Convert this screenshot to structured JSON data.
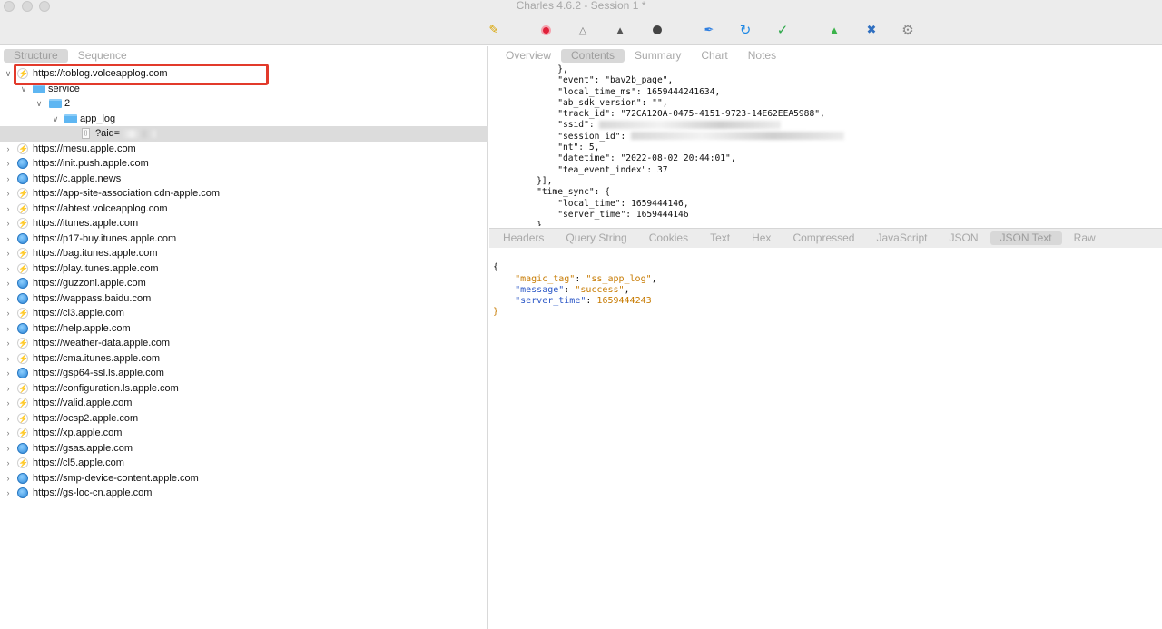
{
  "window": {
    "title": "Charles 4.6.2 - Session 1 *"
  },
  "toolbar": {
    "icons": [
      "broom-icon",
      "record-icon",
      "throttle-icon",
      "turtle-icon",
      "stop-icon",
      "pen-icon",
      "refresh-icon",
      "check-icon",
      "basket-icon",
      "tools-icon",
      "settings-icon"
    ]
  },
  "left_tabs": [
    "Structure",
    "Sequence"
  ],
  "tree": {
    "root": "https://toblog.volceapplog.com",
    "folders": [
      "service",
      "2",
      "app_log"
    ],
    "request": "?aid=",
    "hosts": [
      {
        "label": "https://mesu.apple.com",
        "icon": "bolt"
      },
      {
        "label": "https://init.push.apple.com",
        "icon": "globe"
      },
      {
        "label": "https://c.apple.news",
        "icon": "globe"
      },
      {
        "label": "https://app-site-association.cdn-apple.com",
        "icon": "bolt"
      },
      {
        "label": "https://abtest.volceapplog.com",
        "icon": "bolt"
      },
      {
        "label": "https://itunes.apple.com",
        "icon": "bolt"
      },
      {
        "label": "https://p17-buy.itunes.apple.com",
        "icon": "globe"
      },
      {
        "label": "https://bag.itunes.apple.com",
        "icon": "bolt"
      },
      {
        "label": "https://play.itunes.apple.com",
        "icon": "bolt"
      },
      {
        "label": "https://guzzoni.apple.com",
        "icon": "globe"
      },
      {
        "label": "https://wappass.baidu.com",
        "icon": "globe"
      },
      {
        "label": "https://cl3.apple.com",
        "icon": "bolt"
      },
      {
        "label": "https://help.apple.com",
        "icon": "globe"
      },
      {
        "label": "https://weather-data.apple.com",
        "icon": "bolt"
      },
      {
        "label": "https://cma.itunes.apple.com",
        "icon": "bolt"
      },
      {
        "label": "https://gsp64-ssl.ls.apple.com",
        "icon": "globe"
      },
      {
        "label": "https://configuration.ls.apple.com",
        "icon": "bolt"
      },
      {
        "label": "https://valid.apple.com",
        "icon": "bolt"
      },
      {
        "label": "https://ocsp2.apple.com",
        "icon": "bolt"
      },
      {
        "label": "https://xp.apple.com",
        "icon": "bolt"
      },
      {
        "label": "https://gsas.apple.com",
        "icon": "globe"
      },
      {
        "label": "https://cl5.apple.com",
        "icon": "bolt"
      },
      {
        "label": "https://smp-device-content.apple.com",
        "icon": "globe"
      },
      {
        "label": "https://gs-loc-cn.apple.com",
        "icon": "globe"
      }
    ]
  },
  "right_tabs": [
    "Overview",
    "Contents",
    "Summary",
    "Chart",
    "Notes"
  ],
  "right_active_tab": "Contents",
  "request_body_lines": [
    "        },",
    "        \"event\": \"bav2b_page\",",
    "        \"local_time_ms\": 1659444241634,",
    "        \"ab_sdk_version\": \"\",",
    "        \"track_id\": \"72CA120A-0475-4151-9723-14E62EEA5988\",",
    "        \"ssid\": ",
    "        \"session_id\": ",
    "        \"nt\": 5,",
    "        \"datetime\": \"2022-08-02 20:44:01\",",
    "        \"tea_event_index\": 37",
    "    }],",
    "    \"time_sync\": {",
    "        \"local_time\": 1659444146,",
    "        \"server_time\": 1659444146",
    "    }"
  ],
  "response_tabs": [
    "Headers",
    "Query String",
    "Cookies",
    "Text",
    "Hex",
    "Compressed",
    "JavaScript",
    "JSON",
    "JSON Text",
    "Raw"
  ],
  "response_active_tab": "JSON Text",
  "response": {
    "open": "{",
    "magic_tag_key": "\"magic_tag\"",
    "magic_tag_val": "\"ss_app_log\"",
    "message_key": "\"message\"",
    "message_val": "\"success\"",
    "server_time_key": "\"server_time\"",
    "server_time_val": "1659444243",
    "close": "}"
  }
}
